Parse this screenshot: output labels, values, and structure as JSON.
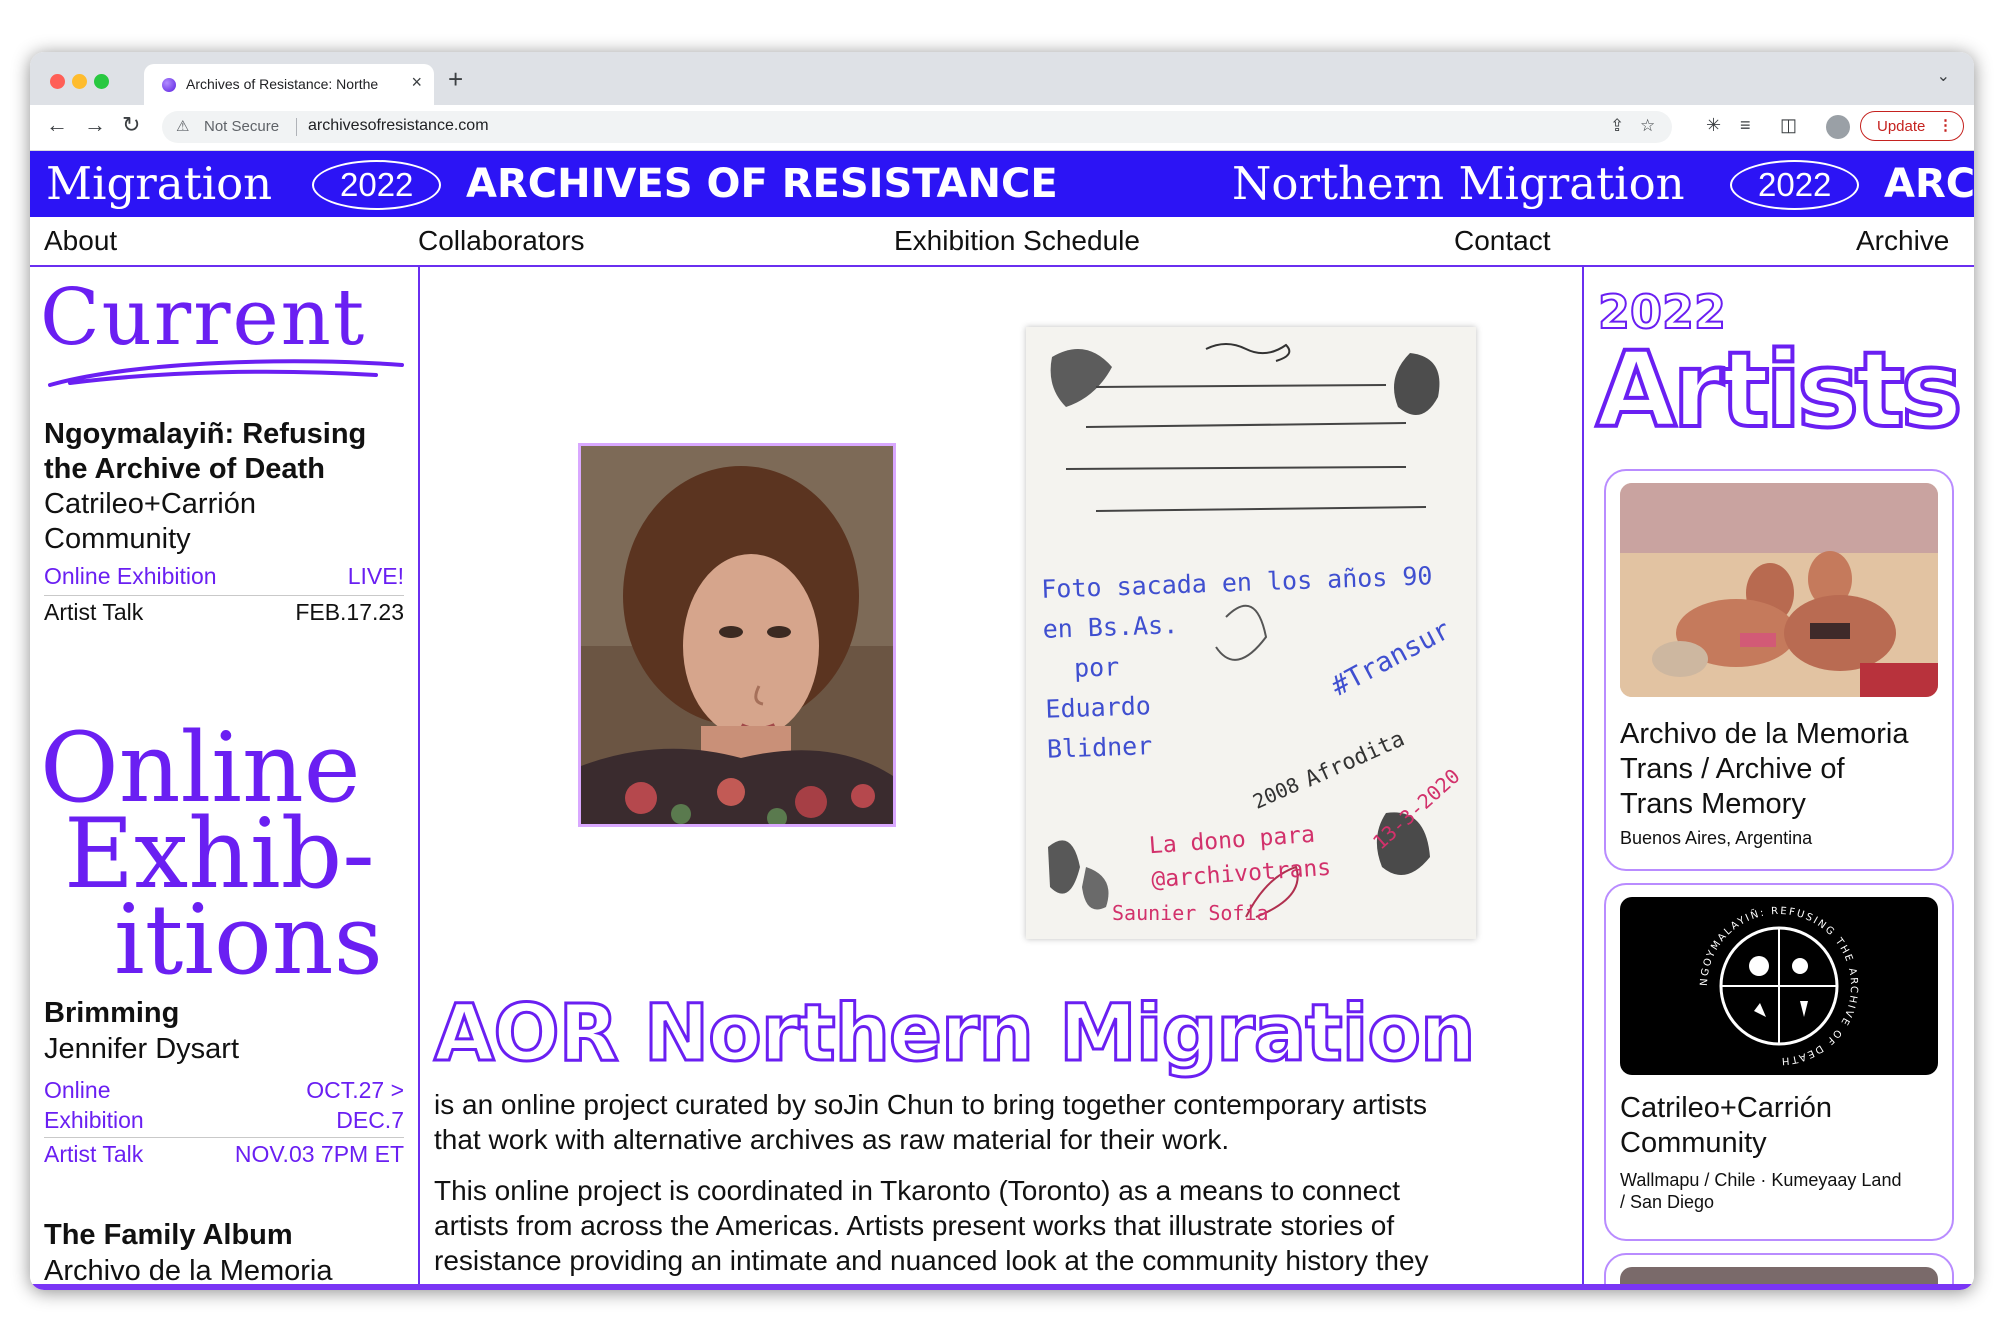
{
  "browser": {
    "tab_title": "Archives of Resistance: Northe",
    "tab_close": "×",
    "new_tab": "+",
    "tab_menu": "⌄",
    "security": "Not Secure",
    "url": "archivesofresistance.com",
    "update_label": "Update",
    "update_menu": "⋮",
    "icons": [
      "back-icon",
      "forward-icon",
      "reload-icon",
      "share-icon",
      "bookmark-star-icon",
      "extensions-icon",
      "reading-list-icon",
      "side-panel-icon",
      "profile-avatar-icon"
    ]
  },
  "banner": {
    "items": [
      {
        "text": "Migration",
        "style": "serif"
      },
      {
        "text": "2022",
        "style": "pill"
      },
      {
        "text": "ARCHIVES OF RESISTANCE",
        "style": "bold"
      },
      {
        "text": "Northern Migration",
        "style": "serif"
      },
      {
        "text": "2022",
        "style": "pill"
      },
      {
        "text": "ARC",
        "style": "bold"
      }
    ]
  },
  "nav": [
    "About",
    "Collaborators",
    "Exhibition Schedule",
    "Contact",
    "Archive"
  ],
  "current": {
    "heading": "Current",
    "title": "Ngoymalayiñ: Refusing the Archive of Death",
    "title_line1": "Ngoymalayiñ: Refusing",
    "title_line2": "the Archive of Death",
    "artist_line1": "Catrileo+Carrión",
    "artist_line2": "Community",
    "rows": [
      {
        "label": "Online Exhibition",
        "value": "LIVE!"
      },
      {
        "label": "Artist Talk",
        "value": "FEB.17.23"
      }
    ]
  },
  "online": {
    "heading_line1": "Online",
    "heading_line2": "Exhib-",
    "heading_line3": "itions",
    "item1": {
      "title": "Brimming",
      "artist": "Jennifer Dysart",
      "label1a": "Online",
      "label1b": "Exhibition",
      "value1a": "OCT.27 >",
      "value1b": "DEC.7",
      "label2": "Artist Talk",
      "value2": "NOV.03 7PM ET"
    },
    "item2": {
      "title": "The Family Album",
      "artist": "Archivo de la Memoria"
    }
  },
  "main": {
    "heading": "AOR Northern Migration",
    "para1_line1": "is an online project curated by soJin Chun to bring together contemporary artists",
    "para1_line2": "that work with alternative archives as raw material for their work.",
    "para2_line1": "This online project is coordinated in Tkaronto (Toronto) as a means to connect",
    "para2_line2": "artists from across the Americas. Artists present works that illustrate stories of",
    "para2_line3": "resistance providing an intimate and nuanced look at the community history they",
    "note_lines": [
      "Foto sacada en los años 90",
      "en Bs.As.",
      "por",
      "Eduardo",
      "Blidner",
      "#Transur",
      "Afrodita",
      "2008",
      "La dono para",
      "@archivotrans",
      "Saunier Sofia",
      "13-3-2020"
    ]
  },
  "artists": {
    "year": "2022",
    "heading": "Artists",
    "cards": [
      {
        "title_line1": "Archivo de la Memoria",
        "title_line2": "Trans / Archive of",
        "title_line3": "Trans Memory",
        "loc_line1": "Buenos Aires, Argentina"
      },
      {
        "title_line1": "Catrileo+Carrión",
        "title_line2": "Community",
        "loc_line1": "Wallmapu / Chile · Kumeyaay Land",
        "loc_line2": "/ San Diego",
        "ring_text": "NGOYMALAYIÑ: REFUSING THE ARCHIVE OF DEATH"
      }
    ]
  },
  "colors": {
    "accent": "#6a1ff2",
    "banner": "#2c14f5",
    "card_border": "#b98cff",
    "note_blue": "#3f4fd0",
    "note_pink": "#d2316b"
  }
}
